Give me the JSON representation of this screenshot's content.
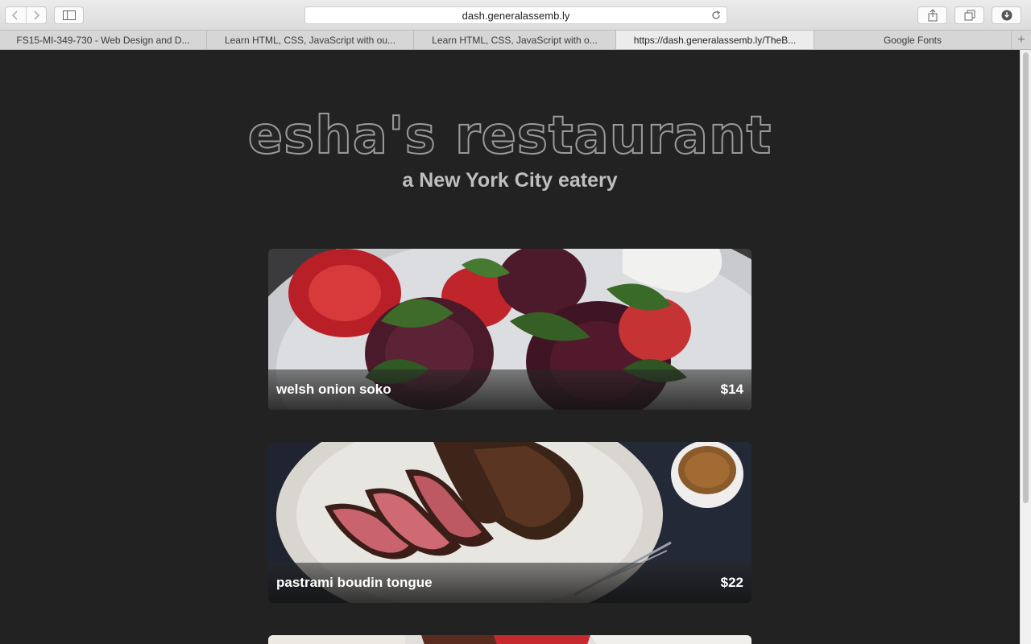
{
  "browser": {
    "address": "dash.generalassemb.ly",
    "tabs": [
      {
        "label": "FS15-MI-349-730 - Web Design and D...",
        "active": false
      },
      {
        "label": "Learn HTML, CSS, JavaScript with ou...",
        "active": false
      },
      {
        "label": "Learn HTML, CSS, JavaScript with o...",
        "active": false
      },
      {
        "label": "https://dash.generalassemb.ly/TheB...",
        "active": true
      },
      {
        "label": "Google Fonts",
        "active": false
      }
    ],
    "icons": [
      "back-icon",
      "forward-icon",
      "sidebar-icon",
      "reload-icon",
      "share-icon",
      "tabs-icon",
      "download-icon",
      "new-tab-icon"
    ]
  },
  "header": {
    "title": "esha's restaurant",
    "subtitle": "a New York City eatery"
  },
  "menu": {
    "items": [
      {
        "name": "welsh onion soko",
        "price": "$14"
      },
      {
        "name": "pastrami boudin tongue",
        "price": "$22"
      }
    ]
  },
  "colors": {
    "page_background": "#222222",
    "title_outline": "#9a9a9a",
    "subtitle": "#bfbfbf"
  }
}
